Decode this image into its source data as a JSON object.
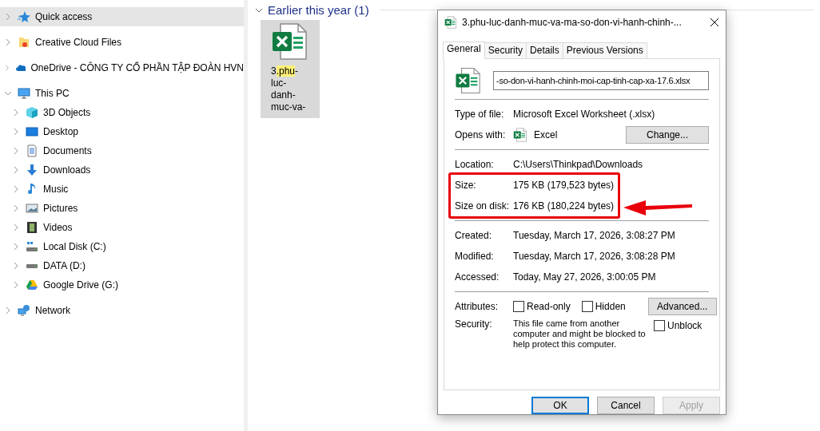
{
  "sidebar": {
    "items": [
      {
        "label": "Quick access",
        "kind": "quick-access",
        "selected": true,
        "expanded": false
      },
      {
        "label": "Creative Cloud Files",
        "kind": "cc-folder",
        "selected": false,
        "expanded": false
      },
      {
        "label": "OneDrive - CÔNG TY CỔ PHẦN TẬP ĐOÀN HVN",
        "kind": "onedrive",
        "selected": false,
        "expanded": false
      },
      {
        "label": "This PC",
        "kind": "pc",
        "selected": false,
        "expanded": true,
        "children": [
          {
            "label": "3D Objects",
            "kind": "cube",
            "selected": false,
            "expanded": false
          },
          {
            "label": "Desktop",
            "kind": "desktop",
            "selected": false,
            "expanded": false
          },
          {
            "label": "Documents",
            "kind": "documents",
            "selected": false,
            "expanded": false
          },
          {
            "label": "Downloads",
            "kind": "downloads",
            "selected": false,
            "expanded": false
          },
          {
            "label": "Music",
            "kind": "music",
            "selected": false,
            "expanded": false
          },
          {
            "label": "Pictures",
            "kind": "pictures",
            "selected": false,
            "expanded": false
          },
          {
            "label": "Videos",
            "kind": "videos",
            "selected": false,
            "expanded": false
          },
          {
            "label": "Local Disk (C:)",
            "kind": "system-disk",
            "selected": false,
            "expanded": false
          },
          {
            "label": "DATA (D:)",
            "kind": "disk",
            "selected": false,
            "expanded": false
          },
          {
            "label": "Google Drive (G:)",
            "kind": "gdrive",
            "selected": false,
            "expanded": false
          }
        ]
      },
      {
        "label": "Network",
        "kind": "network",
        "selected": false,
        "expanded": false
      }
    ]
  },
  "content": {
    "group": {
      "title": "Earlier this year (1)",
      "expanded": true
    },
    "files": [
      {
        "kind": "excel",
        "selected": true,
        "name_parts": [
          {
            "text": "3",
            "highlighted": false
          },
          {
            "text": ".phu",
            "highlighted": true
          },
          {
            "text": "-luc-danh-muc-va-",
            "highlighted": false
          }
        ]
      }
    ]
  },
  "dialog": {
    "title": "3.phu-luc-danh-muc-va-ma-so-don-vi-hanh-chinh-...",
    "tabs": [
      {
        "label": "General",
        "selected": true
      },
      {
        "label": "Security",
        "selected": false
      },
      {
        "label": "Details",
        "selected": false
      },
      {
        "label": "Previous Versions",
        "selected": false
      }
    ],
    "file_name": "-so-don-vi-hanh-chinh-moi-cap-tinh-cap-xa-17.6.xlsx",
    "sections": [
      {
        "rows": [
          {
            "kind": "text",
            "label": "Type of file:",
            "value": "Microsoft Excel Worksheet (.xlsx)"
          },
          {
            "kind": "app",
            "label": "Opens with:",
            "value": "Excel",
            "button": "Change..."
          }
        ]
      },
      {
        "rows": [
          {
            "kind": "text",
            "label": "Location:",
            "value": "C:\\Users\\Thinkpad\\Downloads"
          },
          {
            "kind": "highlight-group",
            "rows": [
              {
                "kind": "text",
                "label": "Size:",
                "value": "175 KB (179,523 bytes)"
              },
              {
                "kind": "text",
                "label": "Size on disk:",
                "value": "176 KB (180,224 bytes)"
              }
            ]
          }
        ]
      },
      {
        "rows": [
          {
            "kind": "text",
            "label": "Created:",
            "value": "Tuesday, March 17, 2026, 3:08:27 PM"
          },
          {
            "kind": "text",
            "label": "Modified:",
            "value": "Tuesday, March 17, 2026, 3:08:28 PM"
          },
          {
            "kind": "text",
            "label": "Accessed:",
            "value": "Today, May 27, 2026, 3:00:05 PM"
          }
        ]
      },
      {
        "rows": [
          {
            "kind": "attributes",
            "label": "Attributes:",
            "checkboxes": [
              {
                "label": "Read-only",
                "checked": false
              },
              {
                "label": "Hidden",
                "checked": false
              }
            ],
            "button": "Advanced..."
          },
          {
            "kind": "security",
            "label": "Security:",
            "value": "This file came from another computer and might be blocked to help protect this computer.",
            "checkbox": {
              "label": "Unblock",
              "checked": false
            }
          }
        ]
      }
    ],
    "buttons": [
      {
        "label": "OK",
        "default": true,
        "disabled": false
      },
      {
        "label": "Cancel",
        "default": false,
        "disabled": false
      },
      {
        "label": "Apply",
        "default": false,
        "disabled": true
      }
    ]
  }
}
